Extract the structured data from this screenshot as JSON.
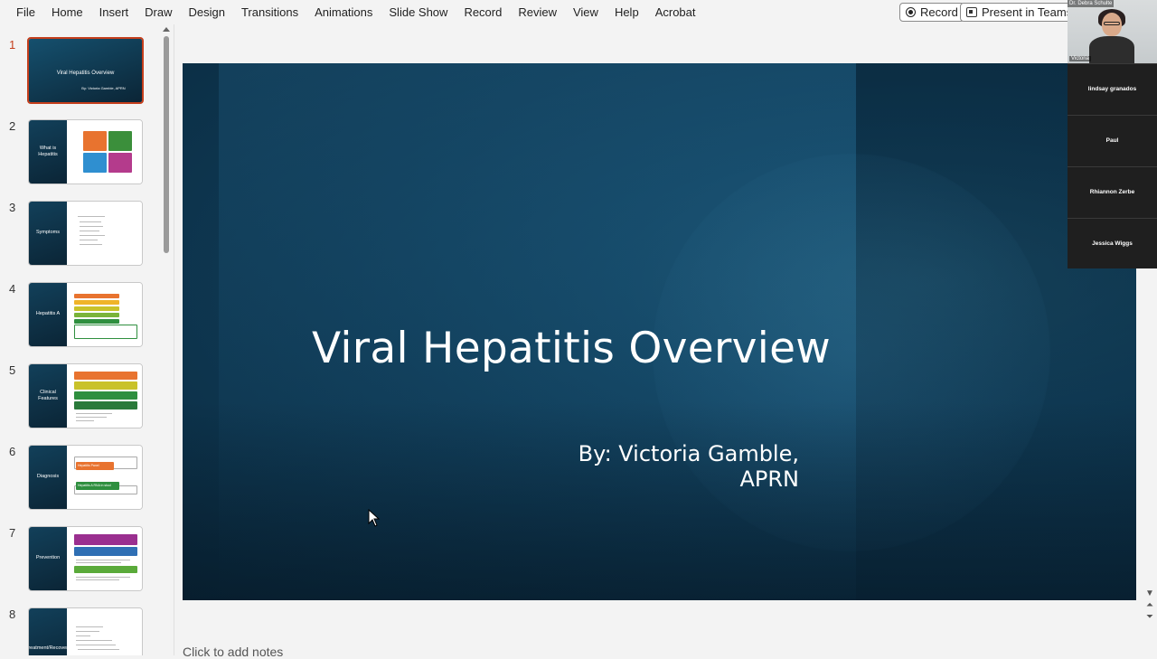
{
  "menu": [
    "File",
    "Home",
    "Insert",
    "Draw",
    "Design",
    "Transitions",
    "Animations",
    "Slide Show",
    "Record",
    "Review",
    "View",
    "Help",
    "Acrobat"
  ],
  "toolbar": {
    "record_label": "Record",
    "present_label": "Present in Teams"
  },
  "thumbnails": [
    {
      "num": "1",
      "title": "Viral Hepatitis Overview",
      "subtitle": "By: Victoria Gamble, APRN"
    },
    {
      "num": "2",
      "title": "What is Hepatitis"
    },
    {
      "num": "3",
      "title": "Symptoms"
    },
    {
      "num": "4",
      "title": "Hepatitis A"
    },
    {
      "num": "5",
      "title": "Clinical Features"
    },
    {
      "num": "6",
      "title": "Diagnosis",
      "box1": "Hepatitis Panel",
      "box2": "Hepatitis A RNA in stool"
    },
    {
      "num": "7",
      "title": "Prevention"
    },
    {
      "num": "8",
      "title": "Treatment/Recovery"
    }
  ],
  "slide": {
    "title": "Viral Hepatitis Overview",
    "subtitle": "By: Victoria Gamble, APRN"
  },
  "notes_placeholder": "Click to add notes",
  "teams": {
    "host_label": "Dr. Debra Schulte",
    "video_name": "Victoria",
    "participants": [
      "lindsay granados",
      "Paul",
      "Rhiannon Zerbe",
      "Jessica Wiggs"
    ]
  },
  "colors": {
    "accent": "#c43e1c",
    "slide_bg": "#0f3a55"
  }
}
